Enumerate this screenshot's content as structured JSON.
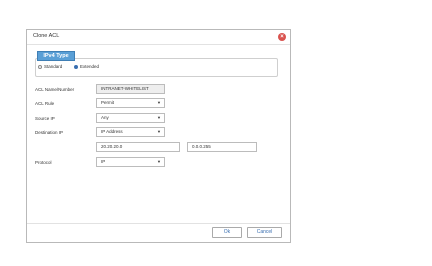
{
  "dialog": {
    "title": "Clone ACL",
    "close_glyph": "×"
  },
  "ipv4_type": {
    "legend": "IPv4 Type",
    "options": [
      {
        "label": "Standard",
        "checked": false
      },
      {
        "label": "Extended",
        "checked": true
      }
    ]
  },
  "form": {
    "acl_name": {
      "label": "ACL Name/Number",
      "value": "INTRANET-WHITELIST"
    },
    "acl_rule": {
      "label": "ACL Rule",
      "value": "Permit"
    },
    "source_ip": {
      "label": "Source IP",
      "value": "Any"
    },
    "destination_ip": {
      "label": "Destination IP",
      "value": "IP Address",
      "address": "20.20.20.0",
      "wildcard": "0.0.0.255"
    },
    "protocol": {
      "label": "Protocol",
      "value": "IP"
    }
  },
  "footer": {
    "ok_label": "Ok",
    "cancel_label": "Cancel"
  },
  "colors": {
    "accent": "#5a9fd6",
    "close": "#d9534f"
  },
  "icons": {
    "close": "close-icon",
    "dropdown": "chevron-down-icon"
  }
}
